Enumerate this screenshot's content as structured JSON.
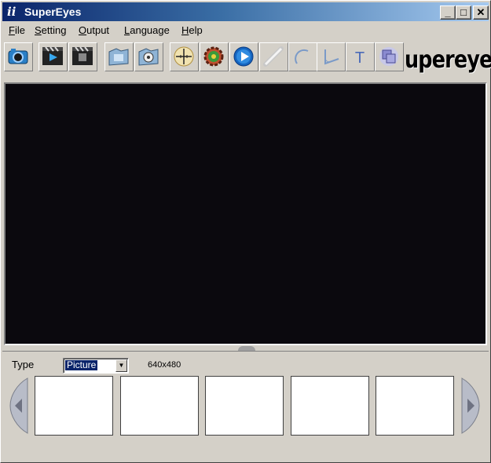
{
  "window": {
    "title": "SuperEyes",
    "app_icon": "superEyes-app-icon",
    "controls": {
      "minimize": "_",
      "maximize": "□",
      "close": "✕"
    }
  },
  "menu": [
    {
      "label": "File",
      "mnemonic": "F"
    },
    {
      "label": "Setting",
      "mnemonic": "S"
    },
    {
      "label": "Output",
      "mnemonic": "O"
    },
    {
      "label": "Language",
      "mnemonic": "L"
    },
    {
      "label": "Help",
      "mnemonic": "H"
    }
  ],
  "toolbar": {
    "tools": [
      {
        "name": "capture-photo",
        "icon": "camera-icon"
      },
      {
        "name": "record-video",
        "icon": "video-clapper-play-icon"
      },
      {
        "name": "stop-video",
        "icon": "video-clapper-stop-icon"
      },
      {
        "name": "open-folder",
        "icon": "folder-icon"
      },
      {
        "name": "open-video-folder",
        "icon": "video-folder-icon"
      },
      {
        "name": "crosshair",
        "icon": "crosshair-icon"
      },
      {
        "name": "settings",
        "icon": "gear-icon"
      },
      {
        "name": "play",
        "icon": "play-icon"
      },
      {
        "name": "measure-line",
        "icon": "ruler-icon"
      },
      {
        "name": "measure-arc",
        "icon": "arc-icon"
      },
      {
        "name": "measure-angle",
        "icon": "angle-icon"
      },
      {
        "name": "text",
        "icon": "text-icon",
        "glyph": "T"
      },
      {
        "name": "overlay",
        "icon": "layers-icon"
      }
    ],
    "logo_text": "upereyes"
  },
  "preview": {
    "background": "#0b090e"
  },
  "capture_panel": {
    "type_label": "Type",
    "type_selected": "Picture",
    "resolution": "640x480",
    "thumbnail_count": 5
  }
}
